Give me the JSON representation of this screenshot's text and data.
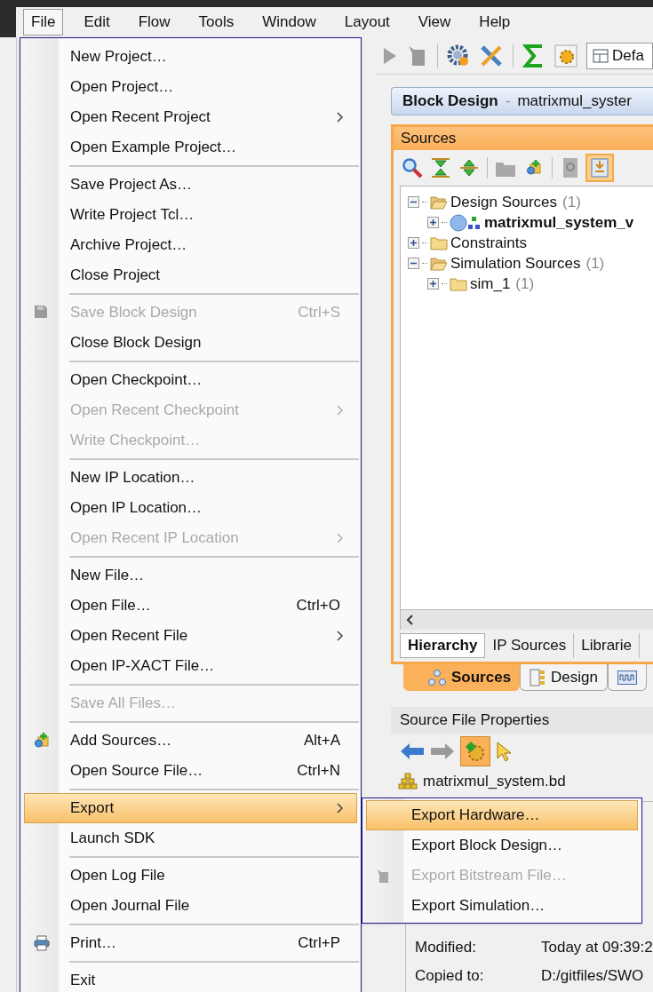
{
  "menubar": [
    {
      "label": "File",
      "selected": true
    },
    {
      "label": "Edit",
      "selected": false
    },
    {
      "label": "Flow",
      "selected": false
    },
    {
      "label": "Tools",
      "selected": false
    },
    {
      "label": "Window",
      "selected": false
    },
    {
      "label": "Layout",
      "selected": false
    },
    {
      "label": "View",
      "selected": false
    },
    {
      "label": "Help",
      "selected": false
    }
  ],
  "file_menu": [
    {
      "kind": "item",
      "label": "New Project…",
      "disabled": false,
      "submenu": false,
      "selected": false
    },
    {
      "kind": "item",
      "label": "Open Project…",
      "disabled": false,
      "submenu": false,
      "selected": false
    },
    {
      "kind": "item",
      "label": "Open Recent Project",
      "disabled": false,
      "submenu": true,
      "selected": false
    },
    {
      "kind": "item",
      "label": "Open Example Project…",
      "disabled": false,
      "submenu": false,
      "selected": false
    },
    {
      "kind": "separator"
    },
    {
      "kind": "item",
      "label": "Save Project As…",
      "disabled": false,
      "submenu": false,
      "selected": false
    },
    {
      "kind": "item",
      "label": "Write Project Tcl…",
      "disabled": false,
      "submenu": false,
      "selected": false
    },
    {
      "kind": "item",
      "label": "Archive Project…",
      "disabled": false,
      "submenu": false,
      "selected": false
    },
    {
      "kind": "item",
      "label": "Close Project",
      "disabled": false,
      "submenu": false,
      "selected": false
    },
    {
      "kind": "separator"
    },
    {
      "kind": "item",
      "label": "Save Block Design",
      "shortcut": "Ctrl+S",
      "disabled": true,
      "submenu": false,
      "selected": false
    },
    {
      "kind": "item",
      "label": "Close Block Design",
      "disabled": false,
      "submenu": false,
      "selected": false
    },
    {
      "kind": "separator"
    },
    {
      "kind": "item",
      "label": "Open Checkpoint…",
      "disabled": false,
      "submenu": false,
      "selected": false
    },
    {
      "kind": "item",
      "label": "Open Recent Checkpoint",
      "disabled": true,
      "submenu": true,
      "selected": false
    },
    {
      "kind": "item",
      "label": "Write Checkpoint…",
      "disabled": true,
      "submenu": false,
      "selected": false
    },
    {
      "kind": "separator"
    },
    {
      "kind": "item",
      "label": "New IP Location…",
      "disabled": false,
      "submenu": false,
      "selected": false
    },
    {
      "kind": "item",
      "label": "Open IP Location…",
      "disabled": false,
      "submenu": false,
      "selected": false
    },
    {
      "kind": "item",
      "label": "Open Recent IP Location",
      "disabled": true,
      "submenu": true,
      "selected": false
    },
    {
      "kind": "separator"
    },
    {
      "kind": "item",
      "label": "New File…",
      "disabled": false,
      "submenu": false,
      "selected": false
    },
    {
      "kind": "item",
      "label": "Open File…",
      "shortcut": "Ctrl+O",
      "disabled": false,
      "submenu": false,
      "selected": false
    },
    {
      "kind": "item",
      "label": "Open Recent File",
      "disabled": false,
      "submenu": true,
      "selected": false
    },
    {
      "kind": "item",
      "label": "Open IP-XACT File…",
      "disabled": false,
      "submenu": false,
      "selected": false
    },
    {
      "kind": "separator"
    },
    {
      "kind": "item",
      "label": "Save All Files…",
      "disabled": true,
      "submenu": false,
      "selected": false
    },
    {
      "kind": "separator"
    },
    {
      "kind": "item",
      "label": "Add Sources…",
      "shortcut": "Alt+A",
      "disabled": false,
      "submenu": false,
      "selected": false
    },
    {
      "kind": "item",
      "label": "Open Source File…",
      "shortcut": "Ctrl+N",
      "disabled": false,
      "submenu": false,
      "selected": false
    },
    {
      "kind": "separator"
    },
    {
      "kind": "item",
      "label": "Export",
      "disabled": false,
      "submenu": true,
      "selected": true
    },
    {
      "kind": "item",
      "label": "Launch SDK",
      "disabled": false,
      "submenu": false,
      "selected": false
    },
    {
      "kind": "separator"
    },
    {
      "kind": "item",
      "label": "Open Log File",
      "disabled": false,
      "submenu": false,
      "selected": false
    },
    {
      "kind": "item",
      "label": "Open Journal File",
      "disabled": false,
      "submenu": false,
      "selected": false
    },
    {
      "kind": "separator"
    },
    {
      "kind": "item",
      "label": "Print…",
      "shortcut": "Ctrl+P",
      "disabled": false,
      "submenu": false,
      "selected": false
    },
    {
      "kind": "separator"
    },
    {
      "kind": "item",
      "label": "Exit",
      "disabled": false,
      "submenu": false,
      "selected": false
    }
  ],
  "export_submenu": [
    {
      "label": "Export Hardware…",
      "disabled": false,
      "selected": true
    },
    {
      "label": "Export Block Design…",
      "disabled": false,
      "selected": false
    },
    {
      "label": "Export Bitstream File…",
      "disabled": true,
      "selected": false
    },
    {
      "label": "Export Simulation…",
      "disabled": false,
      "selected": false
    }
  ],
  "toolbar": {
    "layout_dropdown": "Defa"
  },
  "block_design": {
    "title": "Block Design",
    "dash": "-",
    "name": "matrixmul_syster"
  },
  "sources_panel": {
    "title": "Sources",
    "tree": [
      {
        "kind": "folder",
        "label": "Design Sources",
        "count": "(1)",
        "expanded": true,
        "children": [
          {
            "kind": "top_module",
            "label": "matrixmul_system_v",
            "expanded": false
          }
        ]
      },
      {
        "kind": "folder",
        "label": "Constraints",
        "expanded": false
      },
      {
        "kind": "folder",
        "label": "Simulation Sources",
        "count": "(1)",
        "expanded": true,
        "children": [
          {
            "kind": "folder",
            "label": "sim_1",
            "count": "(1)",
            "expanded": false
          }
        ]
      }
    ],
    "view_tabs": [
      {
        "label": "Hierarchy",
        "selected": true
      },
      {
        "label": "IP Sources",
        "selected": false
      },
      {
        "label": "Librarie",
        "selected": false
      }
    ],
    "panel_tabs": [
      {
        "kind": "sources",
        "label": "Sources",
        "selected": true
      },
      {
        "kind": "design",
        "label": "Design",
        "selected": false
      },
      {
        "kind": "signals",
        "selected": false
      }
    ]
  },
  "properties": {
    "title": "Source File Properties",
    "file": "matrixmul_system.bd",
    "rows": [
      {
        "label": "Modified:",
        "value": "Today at 09:39:2"
      },
      {
        "label": "Copied to:",
        "value": "D:/gitfiles/SWO"
      }
    ]
  }
}
